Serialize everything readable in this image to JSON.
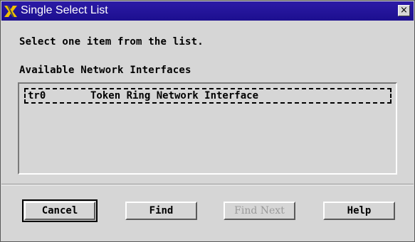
{
  "window": {
    "title": "Single Select List",
    "close_label": "×"
  },
  "instructions": "Select one item from the list.",
  "list_heading": "Available Network Interfaces",
  "list": {
    "items": [
      {
        "name": "tr0",
        "description": "Token Ring Network Interface",
        "focused": true
      }
    ]
  },
  "buttons": {
    "cancel": "Cancel",
    "find": "Find",
    "find_next": "Find Next",
    "help": "Help"
  },
  "colors": {
    "titlebar": "#1c0f8f",
    "dialog_bg": "#d6d6d6",
    "icon": "#f0c000"
  },
  "icons": {
    "title": "x-logo-icon",
    "close": "close-icon"
  }
}
